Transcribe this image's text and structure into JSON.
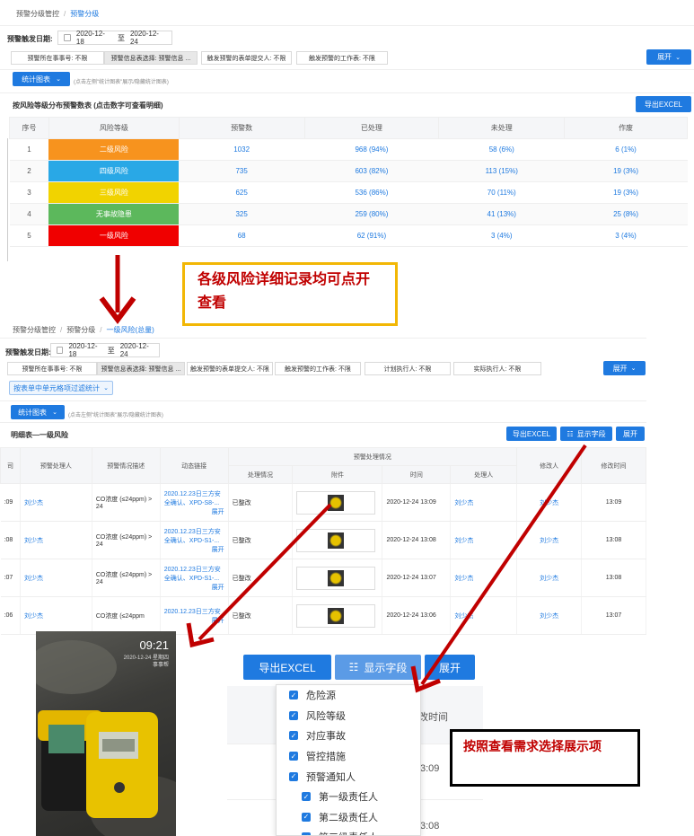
{
  "top": {
    "breadcrumb": [
      "预警分级管控",
      "预警分级"
    ],
    "date_label": "预警触发日期:",
    "date_start": "2020-12-18",
    "date_sep": "至",
    "date_end": "2020-12-24",
    "filters": [
      "预警所在事事号: 不限",
      "预警信息表选择: 预警信息 ...",
      "触发预警的表单提交人: 不限",
      "触发预警的工作表: 不限"
    ],
    "expand": "展开",
    "stats_btn": "统计图表",
    "stats_hint": "(点击左侧\"统计图表\"展示/隐藏统计图表)",
    "table_title": "按风险等级分布预警数表 (点击数字可查看明细)",
    "export": "导出EXCEL",
    "columns": [
      "序号",
      "风险等级",
      "预警数",
      "已处理",
      "未处理",
      "作废"
    ],
    "rows": [
      {
        "idx": "1",
        "level": "二级风险",
        "color": "#f7931e",
        "count": "1032",
        "done": "968 (94%)",
        "todo": "58 (6%)",
        "void": "6 (1%)"
      },
      {
        "idx": "2",
        "level": "四级风险",
        "color": "#29a8e6",
        "count": "735",
        "done": "603 (82%)",
        "todo": "113 (15%)",
        "void": "19 (3%)"
      },
      {
        "idx": "3",
        "level": "三级风险",
        "color": "#f1d300",
        "count": "625",
        "done": "536 (86%)",
        "todo": "70 (11%)",
        "void": "19 (3%)"
      },
      {
        "idx": "4",
        "level": "无事故隐患",
        "color": "#5cb85c",
        "count": "325",
        "done": "259 (80%)",
        "todo": "41 (13%)",
        "void": "25 (8%)"
      },
      {
        "idx": "5",
        "level": "一级风险",
        "color": "#f00000",
        "count": "68",
        "done": "62 (91%)",
        "todo": "3 (4%)",
        "void": "3 (4%)"
      }
    ]
  },
  "callout1": "各级风险详细记录均可点开查看",
  "mid": {
    "breadcrumb": [
      "预警分级管控",
      "预警分级",
      "一级风险(总量)"
    ],
    "date_label": "预警触发日期:",
    "date_start": "2020-12-18",
    "date_sep": "至",
    "date_end": "2020-12-24",
    "filters": [
      "预警所在事事号: 不限",
      "预警信息表选择: 预警信息 ...",
      "触发预警的表单提交人: 不限",
      "触发预警的工作表: 不限",
      "计划执行人: 不限",
      "实际执行人: 不限"
    ],
    "expand": "展开",
    "filter_cell_btn": "按表单中单元格项过滤统计",
    "stats_btn": "统计图表",
    "stats_hint": "(点击左侧\"统计图表\"展示/隐藏统计图表)",
    "table_title": "明细表—一级风险",
    "export": "导出EXCEL",
    "show_fields": "显示字段",
    "expand2": "展开",
    "group_header": "预警处理情况",
    "columns": [
      "司",
      "预警处理人",
      "预警情况描述",
      "动态链接",
      "处理情况",
      "附件",
      "时间",
      "处理人",
      "修改人",
      "修改时间"
    ],
    "expand_link": "展开",
    "rows": [
      {
        "c0": ":09",
        "handler": "刘少杰",
        "desc": "CO浓度 (≤24ppm) > 24",
        "link": "2020.12.23日三方安全确认、XPD-S8-...",
        "status": "已整改",
        "time": "2020-12-24 13:09",
        "by": "刘少杰",
        "mod": "刘少杰",
        "mtime": "13:09"
      },
      {
        "c0": ":08",
        "handler": "刘少杰",
        "desc": "CO浓度 (≤24ppm) > 24",
        "link": "2020.12.23日三方安全确认、XPD-S1-...",
        "status": "已整改",
        "time": "2020-12-24 13:08",
        "by": "刘少杰",
        "mod": "刘少杰",
        "mtime": "13:08"
      },
      {
        "c0": ":07",
        "handler": "刘少杰",
        "desc": "CO浓度 (≤24ppm) > 24",
        "link": "2020.12.23日三方安全确认、XPD-S1-...",
        "status": "已整改",
        "time": "2020-12-24 13:07",
        "by": "刘少杰",
        "mod": "刘少杰",
        "mtime": "13:08"
      },
      {
        "c0": ":06",
        "handler": "刘少杰",
        "desc": "CO浓度 (≤24ppm",
        "link": "2020.12.23日三方安",
        "status": "已整改",
        "time": "2020-12-24 13:06",
        "by": "刘少杰",
        "mod": "刘少杰",
        "mtime": "13:07"
      }
    ]
  },
  "photo": {
    "time": "09:21",
    "date": "2020-12-24 星期四",
    "tag": "事事帮"
  },
  "zoom": {
    "export": "导出EXCEL",
    "show_fields": "显示字段",
    "expand": "展开",
    "col_header": "改时间",
    "times": [
      "3:09",
      "3:08"
    ],
    "menu": [
      "危险源",
      "风险等级",
      "对应事故",
      "管控措施",
      "预警通知人",
      "第一级责任人",
      "第二级责任人",
      "第三级责任人"
    ]
  },
  "callout2": "按照查看需求选择展示项",
  "colors": {
    "accent": "#1f7ae0",
    "arrow": "#c00000"
  }
}
